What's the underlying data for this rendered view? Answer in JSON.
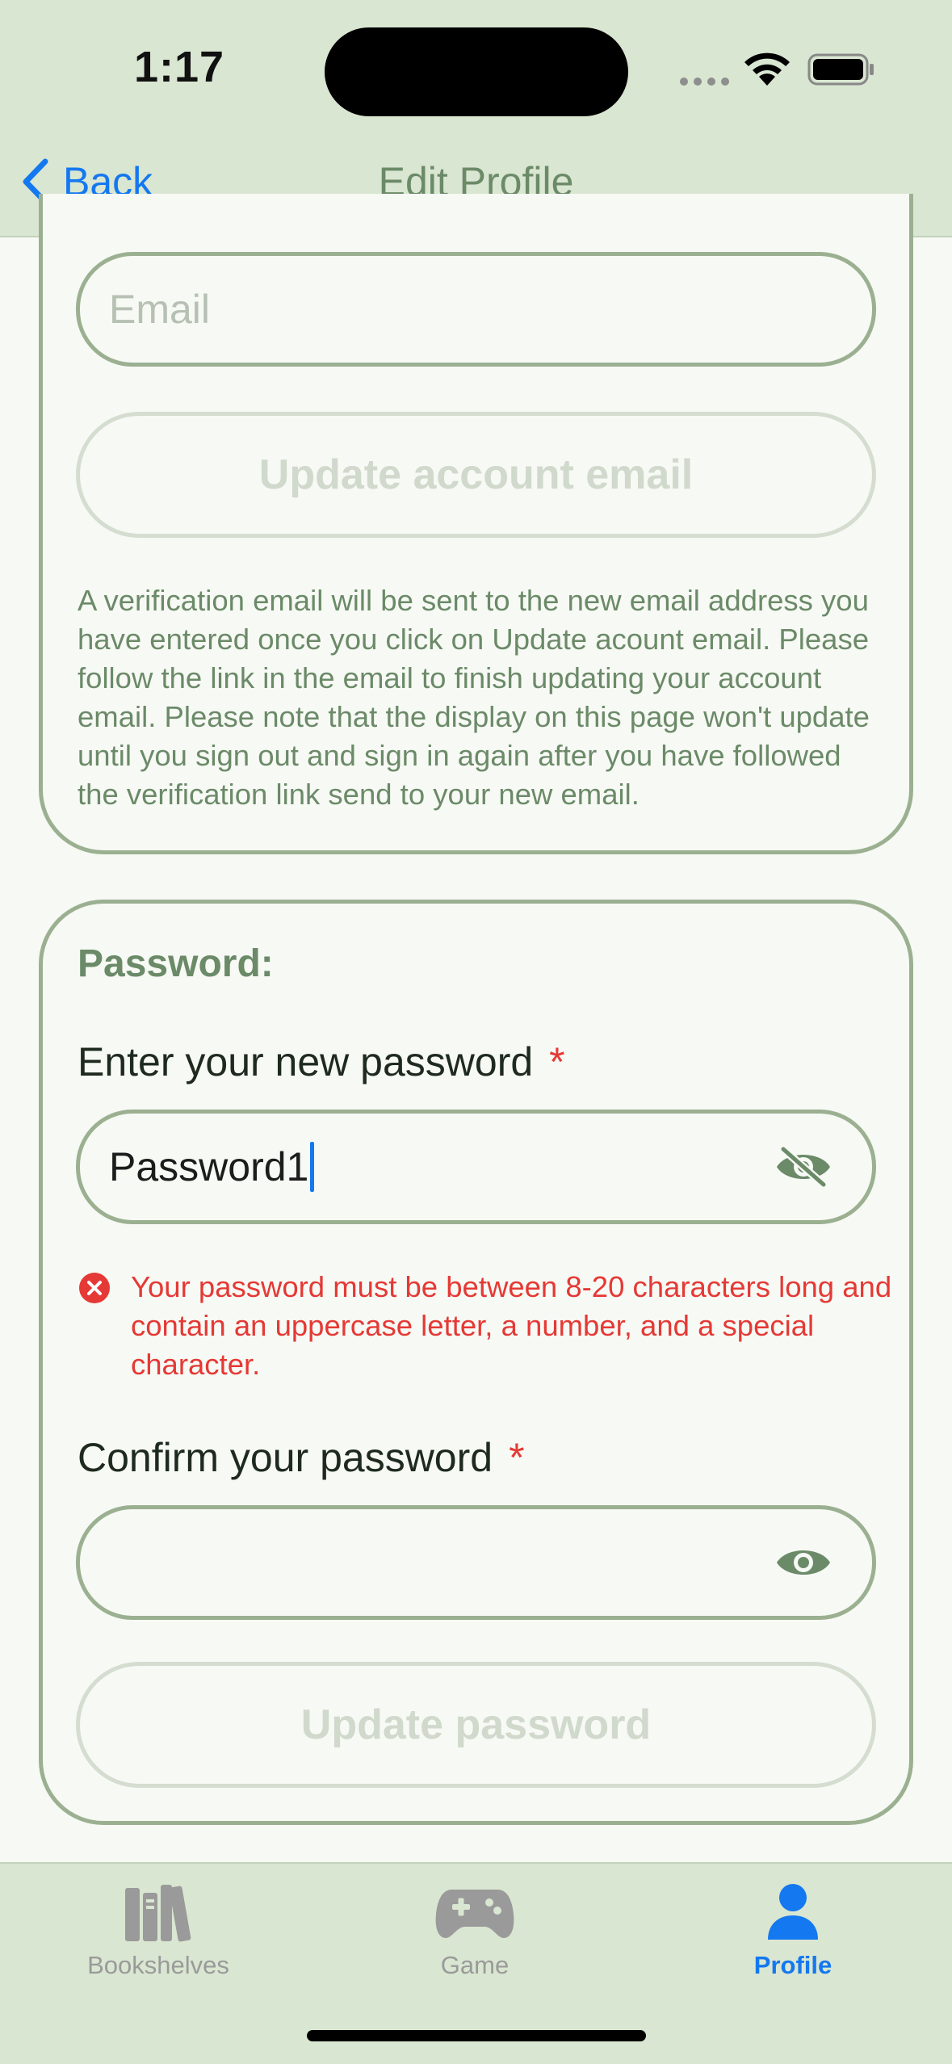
{
  "status_bar": {
    "time": "1:17"
  },
  "nav": {
    "back_label": "Back",
    "title": "Edit Profile"
  },
  "email_section": {
    "email_placeholder": "Email",
    "update_button_label": "Update account email",
    "info_text": "A verification email will be sent to the new email address you have entered once you click on Update acount email. Please follow the link in the email to finish updating your account email. Please note that the display on this page won't update until you sign out and sign in again after you have followed the verification link send to your new email."
  },
  "password_section": {
    "title": "Password:",
    "new_password_label": "Enter your new password",
    "new_password_value": "Password1",
    "error_text": "Your password must be between 8-20 characters long and contain an uppercase letter, a number, and a special character.",
    "confirm_label": "Confirm your password",
    "confirm_value": "",
    "required_mark": "*",
    "update_button_label": "Update password"
  },
  "tabbar": {
    "tabs": [
      {
        "label": "Bookshelves",
        "icon": "books-icon",
        "active": false
      },
      {
        "label": "Game",
        "icon": "gamepad-icon",
        "active": false
      },
      {
        "label": "Profile",
        "icon": "person-icon",
        "active": true
      }
    ]
  },
  "colors": {
    "header_bg": "#d9e6d1",
    "accent_green": "#6b8a68",
    "border_green": "#9bb091",
    "link_blue": "#1478f0",
    "error_red": "#e53935"
  }
}
